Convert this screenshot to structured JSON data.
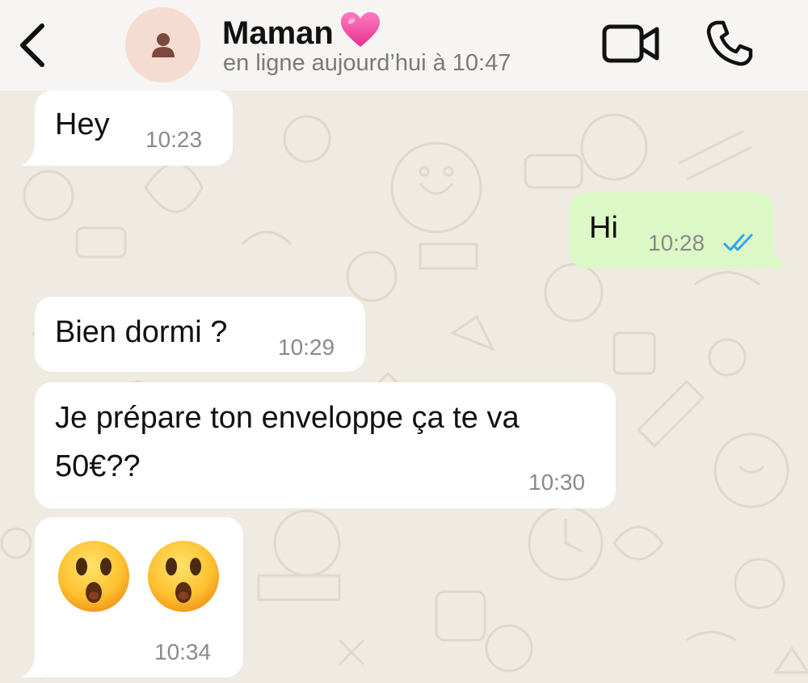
{
  "header": {
    "contact_name": "Maman",
    "status": "en ligne aujourd’hui à 10:47",
    "icons": {
      "back": "chevron-left-icon",
      "avatar": "person-icon",
      "name_emoji": "pink-heart-icon",
      "video": "video-camera-icon",
      "call": "phone-icon"
    }
  },
  "messages": [
    {
      "direction": "incoming",
      "text": "Hey",
      "time": "10:23"
    },
    {
      "direction": "outgoing",
      "text": "Hi",
      "time": "10:28",
      "status": "read",
      "status_icon": "double-check-icon",
      "status_color": "#34a3f5"
    },
    {
      "direction": "incoming",
      "text": "Bien dormi ?",
      "time": "10:29"
    },
    {
      "direction": "incoming",
      "text_line1": "Je prépare ton enveloppe ça te va",
      "text_line2": "50€??",
      "time": "10:30"
    },
    {
      "direction": "incoming",
      "emojis": [
        "hushed-face-emoji",
        "hushed-face-emoji"
      ],
      "time": "10:34"
    }
  ],
  "colors": {
    "header_bg": "#f6f5f3",
    "wallpaper_bg": "#efeae2",
    "incoming_bubble": "#ffffff",
    "outgoing_bubble": "#dcf8c6",
    "read_ticks": "#34a3f5",
    "heart": "#f04ba0"
  }
}
